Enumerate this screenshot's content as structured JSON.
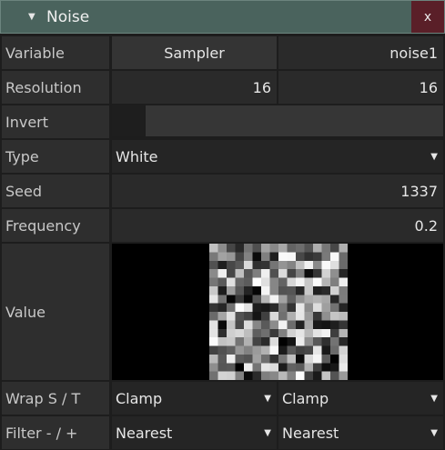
{
  "panel": {
    "title": "Noise",
    "collapse_icon": "triangle-down-icon",
    "close_label": "x"
  },
  "rows": {
    "variable": {
      "label": "Variable",
      "type_value": "Sampler",
      "name_value": "noise1"
    },
    "resolution": {
      "label": "Resolution",
      "x": "16",
      "y": "16"
    },
    "invert": {
      "label": "Invert",
      "checked": false
    },
    "type": {
      "label": "Type",
      "value": "White"
    },
    "seed": {
      "label": "Seed",
      "value": "1337"
    },
    "frequency": {
      "label": "Frequency",
      "value": "0.2"
    },
    "value": {
      "label": "Value"
    },
    "wrap": {
      "label": "Wrap S / T",
      "s": "Clamp",
      "t": "Clamp"
    },
    "filter": {
      "label": "Filter - / +",
      "min": "Nearest",
      "mag": "Nearest"
    }
  },
  "colors": {
    "title_bar": "#4a635d",
    "close_button": "#5a1f28"
  }
}
